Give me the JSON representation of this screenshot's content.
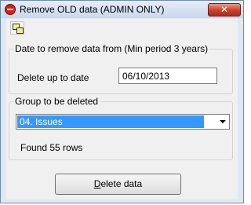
{
  "window": {
    "title": "Remove OLD data (ADMIN ONLY)",
    "close_glyph": "✕",
    "app_icon": "no-entry-icon"
  },
  "toolbar": {
    "icon": "copy-windows-icon"
  },
  "date_group": {
    "legend": "Date to remove data from (Min period 3 years)",
    "label": "Delete up to date",
    "value": "06/10/2013"
  },
  "group_section": {
    "legend": "Group to be deleted",
    "selected": "04. Issues",
    "status": "Found 55 rows"
  },
  "delete_button": {
    "mnemonic": "D",
    "rest": "elete data"
  },
  "colors": {
    "selection": "#3399ff",
    "close_button": "#c8402c",
    "frame": "#dfe8f3"
  }
}
